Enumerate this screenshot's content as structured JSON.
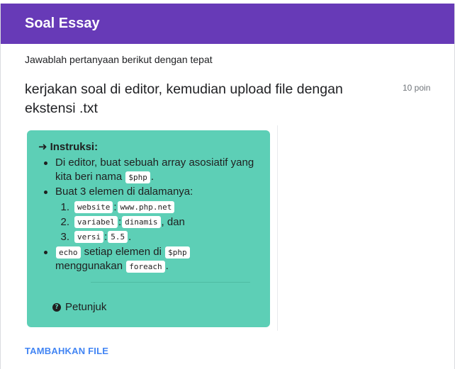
{
  "form": {
    "title": "Soal Essay",
    "description": "Jawablah pertanyaan berikut dengan tepat"
  },
  "question": {
    "text": "kerjakan soal di editor, kemudian upload file dengan ekstensi .txt",
    "points": "10 poin"
  },
  "instructions": {
    "arrow": "➜",
    "heading": "Instruksi:",
    "b1_text": "Di editor, buat sebuah array asosiatif yang kita beri nama",
    "b1_code": "$php",
    "b1_end": ".",
    "b2_text": "Buat 3 elemen di dalamanya:",
    "items": [
      {
        "num": "1.",
        "key": "website",
        "sep": ":",
        "val": "www.php.net",
        "after": ""
      },
      {
        "num": "2.",
        "key": "variabel",
        "sep": ":",
        "val": "dinamis",
        "after": ", dan"
      },
      {
        "num": "3.",
        "key": "versi",
        "sep": ":",
        "val": "5.5",
        "after": "."
      }
    ],
    "b3_code1": "echo",
    "b3_text1": "setiap elemen di",
    "b3_code2": "$php",
    "b3_text2": "menggunakan",
    "b3_code3": "foreach",
    "b3_end": "."
  },
  "hint": {
    "icon_glyph": "?",
    "label": "Petunjuk"
  },
  "actions": {
    "add_file": "TAMBAHKAN FILE"
  },
  "colors": {
    "header": "#673ab7",
    "instruction_bg": "#5dcfb6",
    "link": "#4285f4"
  }
}
